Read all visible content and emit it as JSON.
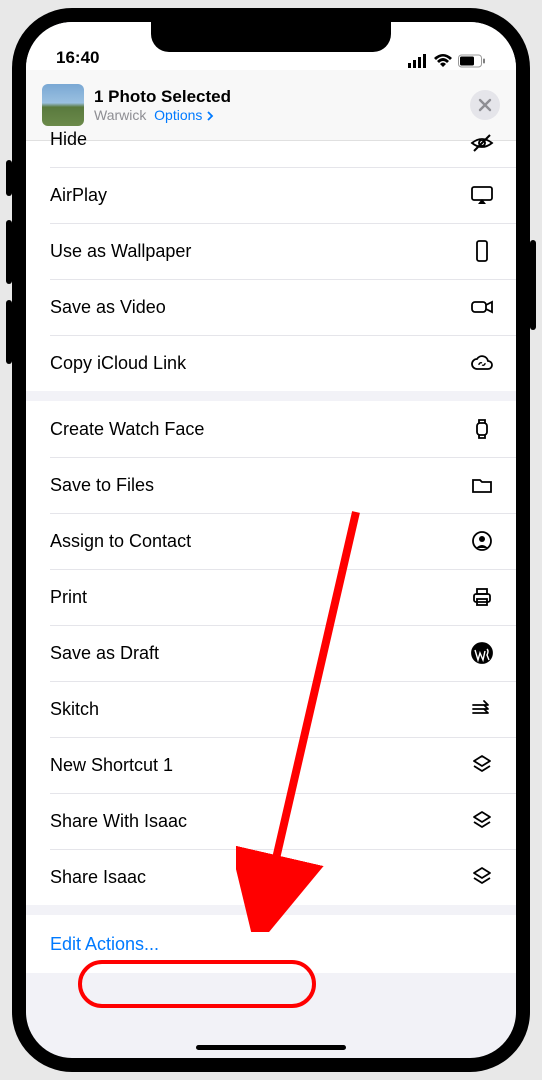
{
  "status": {
    "time": "16:40"
  },
  "header": {
    "title": "1 Photo Selected",
    "subtitle_location": "Warwick",
    "subtitle_link": "Options",
    "close": "✕"
  },
  "section1": {
    "hide": "Hide",
    "airplay": "AirPlay",
    "wallpaper": "Use as Wallpaper",
    "save_video": "Save as Video",
    "copy_icloud": "Copy iCloud Link"
  },
  "section2": {
    "watch_face": "Create Watch Face",
    "save_files": "Save to Files",
    "assign_contact": "Assign to Contact",
    "print": "Print",
    "save_draft": "Save as Draft",
    "skitch": "Skitch",
    "new_shortcut": "New Shortcut 1",
    "share_with_isaac": "Share With Isaac",
    "share_isaac": "Share Isaac"
  },
  "footer": {
    "edit_actions": "Edit Actions..."
  }
}
